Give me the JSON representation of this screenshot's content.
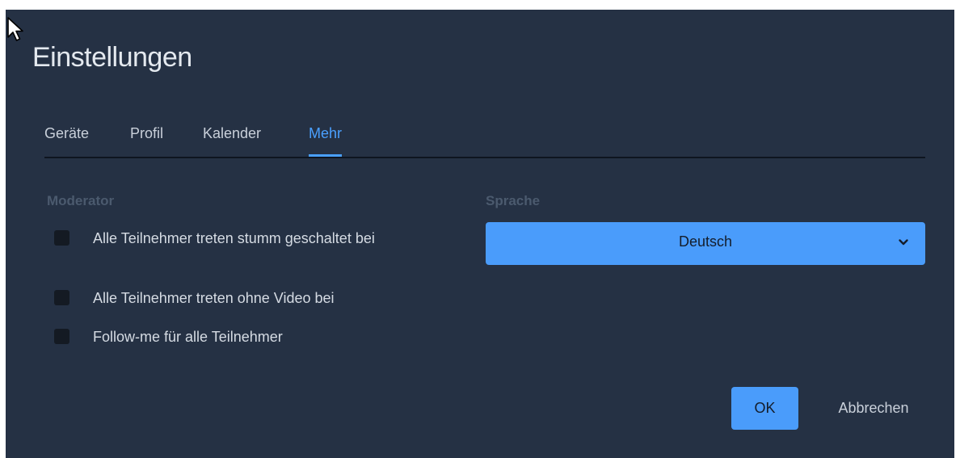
{
  "dialog": {
    "title": "Einstellungen"
  },
  "tabs": [
    {
      "label": "Geräte",
      "active": false
    },
    {
      "label": "Profil",
      "active": false
    },
    {
      "label": "Kalender",
      "active": false
    },
    {
      "label": "Mehr",
      "active": true
    }
  ],
  "moderator": {
    "heading": "Moderator",
    "options": [
      {
        "label": "Alle Teilnehmer treten stumm geschaltet bei",
        "checked": false
      },
      {
        "label": "Alle Teilnehmer treten ohne Video bei",
        "checked": false
      },
      {
        "label": "Follow-me für alle Teilnehmer",
        "checked": false
      }
    ]
  },
  "language": {
    "heading": "Sprache",
    "selected": "Deutsch",
    "icon": "chevron-down-icon"
  },
  "buttons": {
    "ok_label": "OK",
    "cancel_label": "Abbrechen"
  },
  "colors": {
    "background": "#253144",
    "accent": "#4a9cfb",
    "active_tab": "#4aa0ff",
    "section_label": "#4b5a6e"
  }
}
